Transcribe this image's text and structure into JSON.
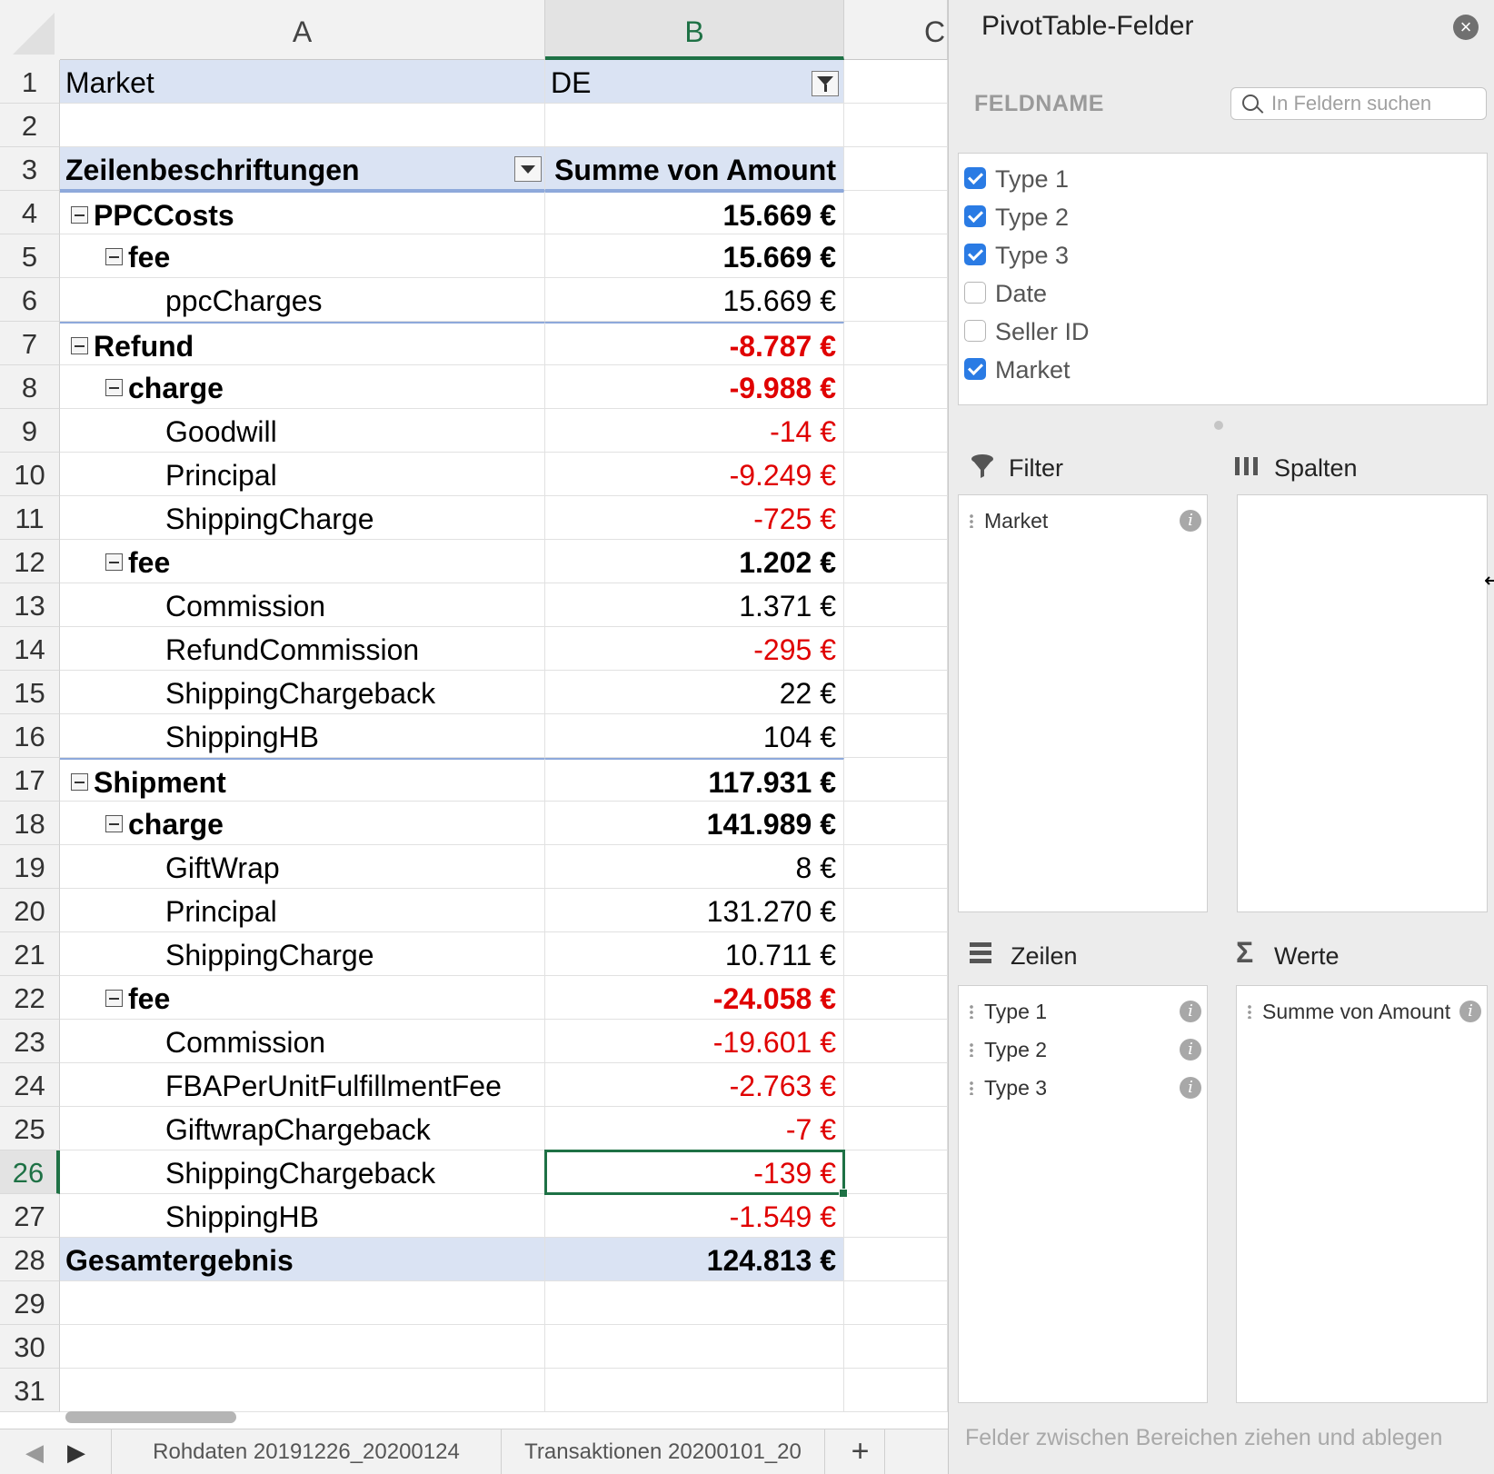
{
  "sheet": {
    "columns": [
      "A",
      "B",
      "C"
    ],
    "selected_column": "B",
    "selected_row": "26",
    "rows": [
      {
        "n": "1",
        "a": "Market",
        "b": "DE",
        "level": "filter"
      },
      {
        "n": "2",
        "a": "",
        "b": "",
        "level": "empty"
      },
      {
        "n": "3",
        "a": "Zeilenbeschriftungen",
        "b": "Summe von Amount",
        "level": "header"
      },
      {
        "n": "4",
        "a": "PPCCosts",
        "b": "15.669 €",
        "level": 1,
        "neg": false
      },
      {
        "n": "5",
        "a": "fee",
        "b": "15.669 €",
        "level": 2,
        "neg": false
      },
      {
        "n": "6",
        "a": "ppcCharges",
        "b": "15.669 €",
        "level": 3,
        "neg": false
      },
      {
        "n": "7",
        "a": "Refund",
        "b": "-8.787 €",
        "level": 1,
        "neg": true
      },
      {
        "n": "8",
        "a": "charge",
        "b": "-9.988 €",
        "level": 2,
        "neg": true
      },
      {
        "n": "9",
        "a": "Goodwill",
        "b": "-14 €",
        "level": 3,
        "neg": true
      },
      {
        "n": "10",
        "a": "Principal",
        "b": "-9.249 €",
        "level": 3,
        "neg": true
      },
      {
        "n": "11",
        "a": "ShippingCharge",
        "b": "-725 €",
        "level": 3,
        "neg": true
      },
      {
        "n": "12",
        "a": "fee",
        "b": "1.202 €",
        "level": 2,
        "neg": false
      },
      {
        "n": "13",
        "a": "Commission",
        "b": "1.371 €",
        "level": 3,
        "neg": false
      },
      {
        "n": "14",
        "a": "RefundCommission",
        "b": "-295 €",
        "level": 3,
        "neg": true
      },
      {
        "n": "15",
        "a": "ShippingChargeback",
        "b": "22 €",
        "level": 3,
        "neg": false
      },
      {
        "n": "16",
        "a": "ShippingHB",
        "b": "104 €",
        "level": 3,
        "neg": false
      },
      {
        "n": "17",
        "a": "Shipment",
        "b": "117.931 €",
        "level": 1,
        "neg": false
      },
      {
        "n": "18",
        "a": "charge",
        "b": "141.989 €",
        "level": 2,
        "neg": false
      },
      {
        "n": "19",
        "a": "GiftWrap",
        "b": "8 €",
        "level": 3,
        "neg": false
      },
      {
        "n": "20",
        "a": "Principal",
        "b": "131.270 €",
        "level": 3,
        "neg": false
      },
      {
        "n": "21",
        "a": "ShippingCharge",
        "b": "10.711 €",
        "level": 3,
        "neg": false
      },
      {
        "n": "22",
        "a": "fee",
        "b": "-24.058 €",
        "level": 2,
        "neg": true
      },
      {
        "n": "23",
        "a": "Commission",
        "b": "-19.601 €",
        "level": 3,
        "neg": true
      },
      {
        "n": "24",
        "a": "FBAPerUnitFulfillmentFee",
        "b": "-2.763 €",
        "level": 3,
        "neg": true
      },
      {
        "n": "25",
        "a": "GiftwrapChargeback",
        "b": "-7 €",
        "level": 3,
        "neg": true
      },
      {
        "n": "26",
        "a": "ShippingChargeback",
        "b": "-139 €",
        "level": 3,
        "neg": true
      },
      {
        "n": "27",
        "a": "ShippingHB",
        "b": "-1.549 €",
        "level": 3,
        "neg": true
      },
      {
        "n": "28",
        "a": "Gesamtergebnis",
        "b": "124.813 €",
        "level": "total",
        "neg": false
      },
      {
        "n": "29",
        "a": "",
        "b": "",
        "level": "empty"
      },
      {
        "n": "30",
        "a": "",
        "b": "",
        "level": "empty"
      },
      {
        "n": "31",
        "a": "",
        "b": "",
        "level": "empty"
      }
    ],
    "tabs": [
      "Rohdaten 20191226_20200124",
      "Transaktionen 20200101_20"
    ],
    "add_tab_label": "+",
    "colors": {
      "negative": "#e00000",
      "header_band": "#dae3f3",
      "selection": "#1e7145"
    }
  },
  "pane": {
    "title": "PivotTable-Felder",
    "close_icon": "×",
    "feldname_label": "FELDNAME",
    "search_placeholder": "In Feldern suchen",
    "fields": [
      {
        "label": "Type 1",
        "checked": true
      },
      {
        "label": "Type 2",
        "checked": true
      },
      {
        "label": "Type 3",
        "checked": true
      },
      {
        "label": "Date",
        "checked": false
      },
      {
        "label": "Seller ID",
        "checked": false
      },
      {
        "label": "Market",
        "checked": true
      }
    ],
    "areas": {
      "filter": {
        "label": "Filter",
        "items": [
          "Market"
        ]
      },
      "columns": {
        "label": "Spalten",
        "items": []
      },
      "rows": {
        "label": "Zeilen",
        "items": [
          "Type 1",
          "Type 2",
          "Type 3"
        ]
      },
      "values": {
        "label": "Werte",
        "items": [
          "Summe von Amount"
        ]
      }
    },
    "hint": "Felder zwischen Bereichen ziehen und ablegen",
    "accent": "#2a7be4"
  }
}
